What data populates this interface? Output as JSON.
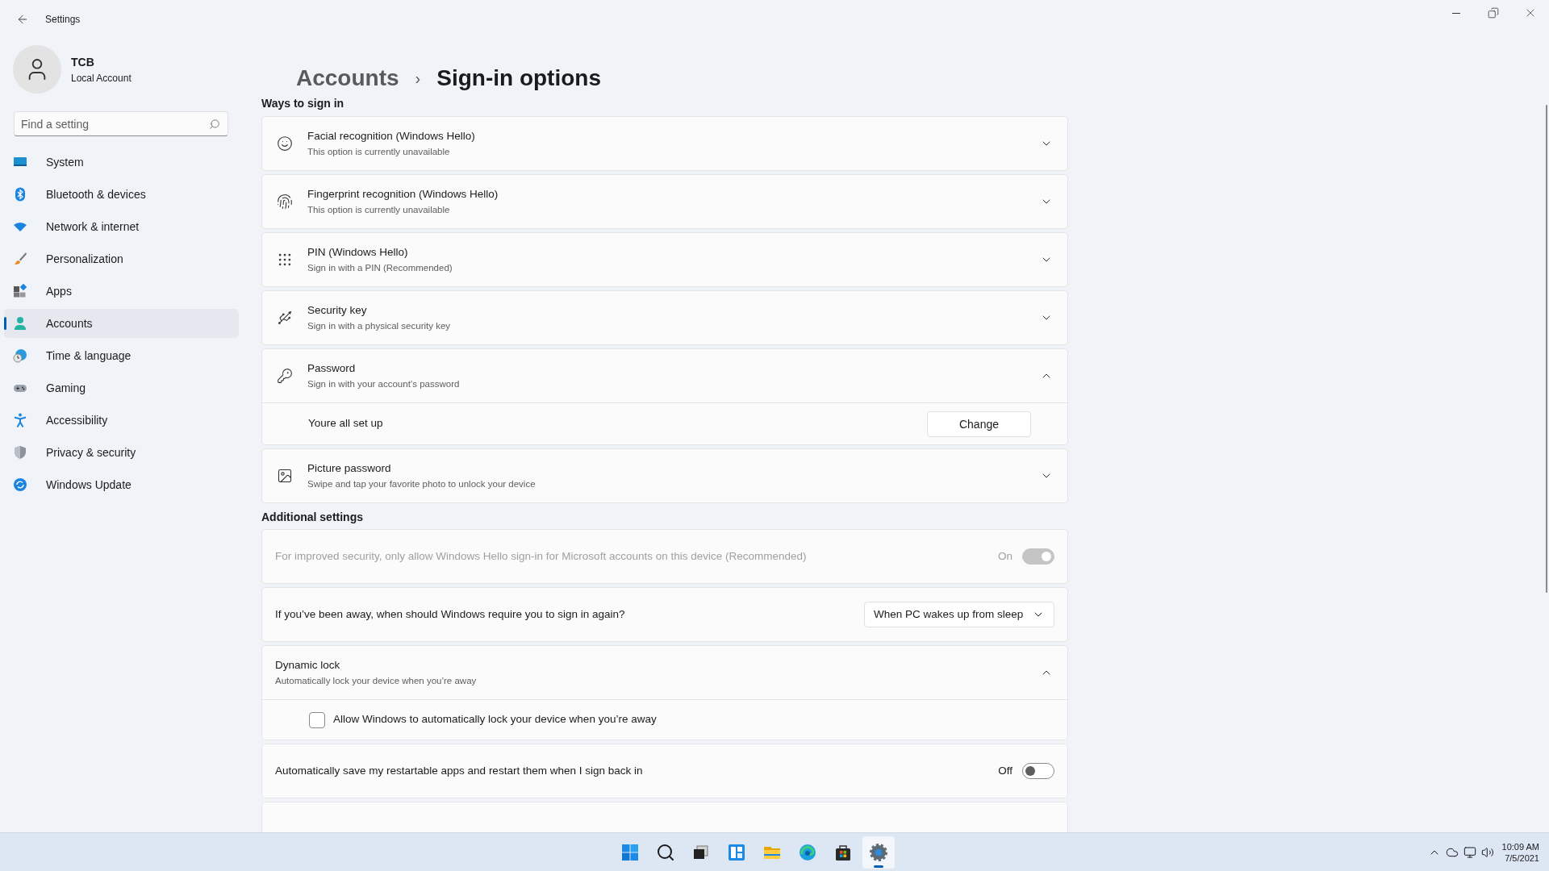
{
  "window": {
    "title": "Settings"
  },
  "user": {
    "name": "TCB",
    "account": "Local Account"
  },
  "search": {
    "placeholder": "Find a setting"
  },
  "nav": [
    {
      "label": "System",
      "selected": false
    },
    {
      "label": "Bluetooth & devices",
      "selected": false
    },
    {
      "label": "Network & internet",
      "selected": false
    },
    {
      "label": "Personalization",
      "selected": false
    },
    {
      "label": "Apps",
      "selected": false
    },
    {
      "label": "Accounts",
      "selected": true
    },
    {
      "label": "Time & language",
      "selected": false
    },
    {
      "label": "Gaming",
      "selected": false
    },
    {
      "label": "Accessibility",
      "selected": false
    },
    {
      "label": "Privacy & security",
      "selected": false
    },
    {
      "label": "Windows Update",
      "selected": false
    }
  ],
  "breadcrumb": {
    "parent": "Accounts",
    "separator": "›",
    "current": "Sign-in options"
  },
  "ways_heading": "Ways to sign in",
  "sign_in_options": [
    {
      "title": "Facial recognition (Windows Hello)",
      "subtitle": "This option is currently unavailable",
      "expanded": false
    },
    {
      "title": "Fingerprint recognition (Windows Hello)",
      "subtitle": "This option is currently unavailable",
      "expanded": false
    },
    {
      "title": "PIN (Windows Hello)",
      "subtitle": "Sign in with a PIN (Recommended)",
      "expanded": false
    },
    {
      "title": "Security key",
      "subtitle": "Sign in with a physical security key",
      "expanded": false
    },
    {
      "title": "Password",
      "subtitle": "Sign in with your account’s password",
      "expanded": true,
      "detail": {
        "text": "Youre all set up",
        "button": "Change"
      }
    },
    {
      "title": "Picture password",
      "subtitle": "Swipe and tap your favorite photo to unlock your device",
      "expanded": false
    }
  ],
  "additional_heading": "Additional settings",
  "additional_settings": [
    {
      "kind": "toggle",
      "label": "For improved security, only allow Windows Hello sign-in for Microsoft accounts on this device (Recommended)",
      "state_label": "On",
      "on": true,
      "disabled": true
    },
    {
      "kind": "dropdown",
      "label": "If you’ve been away, when should Windows require you to sign in again?",
      "value": "When PC wakes up from sleep"
    },
    {
      "kind": "expander",
      "title": "Dynamic lock",
      "subtitle": "Automatically lock your device when you’re away",
      "expanded": true,
      "checkbox": {
        "label": "Allow Windows to automatically lock your device when you’re away",
        "checked": false
      }
    },
    {
      "kind": "toggle",
      "label": "Automatically save my restartable apps and restart them when I sign back in",
      "state_label": "Off",
      "on": false,
      "disabled": false
    },
    {
      "kind": "cutoff"
    }
  ],
  "taskbar": {
    "apps": [
      {
        "active": false
      },
      {
        "active": false
      },
      {
        "active": false
      },
      {
        "active": false
      },
      {
        "active": false
      },
      {
        "active": false
      },
      {
        "active": false
      },
      {
        "active": true
      }
    ],
    "time": "10:09 AM",
    "date": "7/5/2021"
  }
}
